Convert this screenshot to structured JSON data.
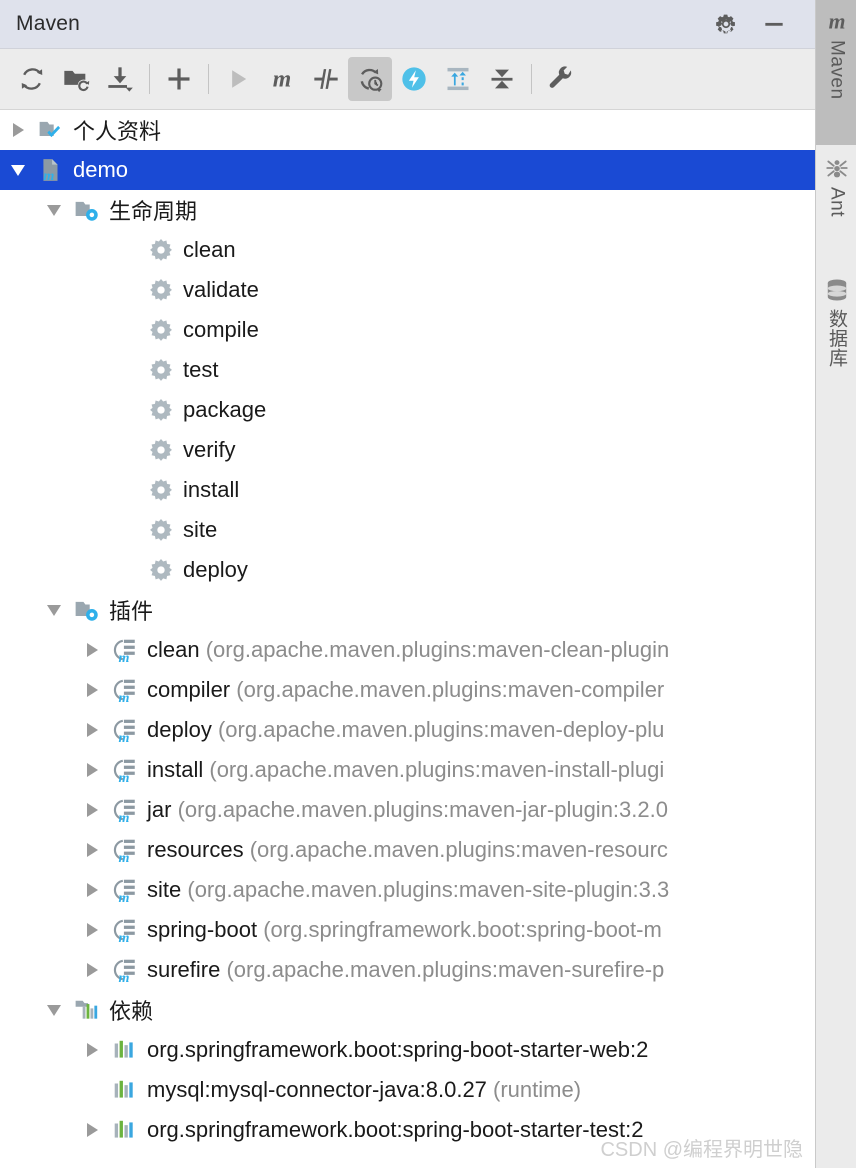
{
  "window": {
    "title": "Maven",
    "settings_icon": "gear-icon",
    "minimize_icon": "minimize-icon"
  },
  "toolbar": {
    "buttons": [
      {
        "name": "reload-all-maven-projects",
        "icon": "refresh-icon",
        "active": false
      },
      {
        "name": "generate-sources-and-update-folders",
        "icon": "folder-refresh-icon",
        "active": false
      },
      {
        "name": "download-sources-and-documentation",
        "icon": "download-icon",
        "active": false
      },
      {
        "name": "add-maven-project",
        "icon": "plus-icon",
        "active": false
      },
      {
        "name": "run-maven-build",
        "icon": "run-icon",
        "active": false
      },
      {
        "name": "execute-maven-goal",
        "icon": "maven-m-icon",
        "active": false
      },
      {
        "name": "toggle-skip-tests-mode",
        "icon": "skip-tests-icon",
        "active": false
      },
      {
        "name": "toggle-offline-mode",
        "icon": "offline-mode-icon",
        "active": true
      },
      {
        "name": "show-dependencies",
        "icon": "lightning-icon",
        "active": false
      },
      {
        "name": "expand-all",
        "icon": "expand-all-icon",
        "active": false
      },
      {
        "name": "collapse-all",
        "icon": "collapse-all-icon",
        "active": false
      },
      {
        "name": "maven-settings",
        "icon": "wrench-icon",
        "active": false
      }
    ]
  },
  "tree": {
    "profiles": {
      "label": "个人资料",
      "icon": "folder-check-icon",
      "expanded": false
    },
    "project": {
      "label": "demo",
      "icon": "maven-project-icon",
      "expanded": true,
      "selected": true
    },
    "lifecycle": {
      "label": "生命周期",
      "icon": "folder-gear-icon",
      "expanded": true,
      "goals": [
        {
          "label": "clean",
          "icon": "gear-icon"
        },
        {
          "label": "validate",
          "icon": "gear-icon"
        },
        {
          "label": "compile",
          "icon": "gear-icon"
        },
        {
          "label": "test",
          "icon": "gear-icon"
        },
        {
          "label": "package",
          "icon": "gear-icon"
        },
        {
          "label": "verify",
          "icon": "gear-icon"
        },
        {
          "label": "install",
          "icon": "gear-icon"
        },
        {
          "label": "site",
          "icon": "gear-icon"
        },
        {
          "label": "deploy",
          "icon": "gear-icon"
        }
      ]
    },
    "plugins": {
      "label": "插件",
      "icon": "folder-gear-icon",
      "expanded": true,
      "items": [
        {
          "name": "clean",
          "coords": "(org.apache.maven.plugins:maven-clean-plugin",
          "icon": "maven-plugin-icon"
        },
        {
          "name": "compiler",
          "coords": "(org.apache.maven.plugins:maven-compiler",
          "icon": "maven-plugin-icon"
        },
        {
          "name": "deploy",
          "coords": "(org.apache.maven.plugins:maven-deploy-plu",
          "icon": "maven-plugin-icon"
        },
        {
          "name": "install",
          "coords": "(org.apache.maven.plugins:maven-install-plugi",
          "icon": "maven-plugin-icon"
        },
        {
          "name": "jar",
          "coords": "(org.apache.maven.plugins:maven-jar-plugin:3.2.0",
          "icon": "maven-plugin-icon"
        },
        {
          "name": "resources",
          "coords": "(org.apache.maven.plugins:maven-resourc",
          "icon": "maven-plugin-icon"
        },
        {
          "name": "site",
          "coords": "(org.apache.maven.plugins:maven-site-plugin:3.3",
          "icon": "maven-plugin-icon"
        },
        {
          "name": "spring-boot",
          "coords": "(org.springframework.boot:spring-boot-m",
          "icon": "maven-plugin-icon"
        },
        {
          "name": "surefire",
          "coords": "(org.apache.maven.plugins:maven-surefire-p",
          "icon": "maven-plugin-icon"
        }
      ]
    },
    "dependencies": {
      "label": "依赖",
      "icon": "dependencies-folder-icon",
      "expanded": true,
      "items": [
        {
          "label": "org.springframework.boot:spring-boot-starter-web:2",
          "scope": "",
          "icon": "dependency-icon",
          "expandable": true
        },
        {
          "label": "mysql:mysql-connector-java:8.0.27",
          "scope": "(runtime)",
          "icon": "dependency-icon",
          "expandable": false
        },
        {
          "label": "org.springframework.boot:spring-boot-starter-test:2",
          "scope": "",
          "icon": "dependency-icon",
          "expandable": true
        }
      ]
    }
  },
  "side_tabs": [
    {
      "label": "Maven",
      "icon": "maven-m-icon",
      "active": true
    },
    {
      "label": "Ant",
      "icon": "ant-icon",
      "active": false
    },
    {
      "label": "数据库",
      "icon": "database-icon",
      "active": false
    }
  ],
  "watermark": "CSDN @编程界明世隐",
  "colors": {
    "selection": "#1a4ad4",
    "titlebar": "#dfe2ec",
    "toolbar": "#ececec",
    "sidestrip": "#ebebeb",
    "accent_blue": "#2fb0ea",
    "dim_text": "#8c8c8c"
  }
}
